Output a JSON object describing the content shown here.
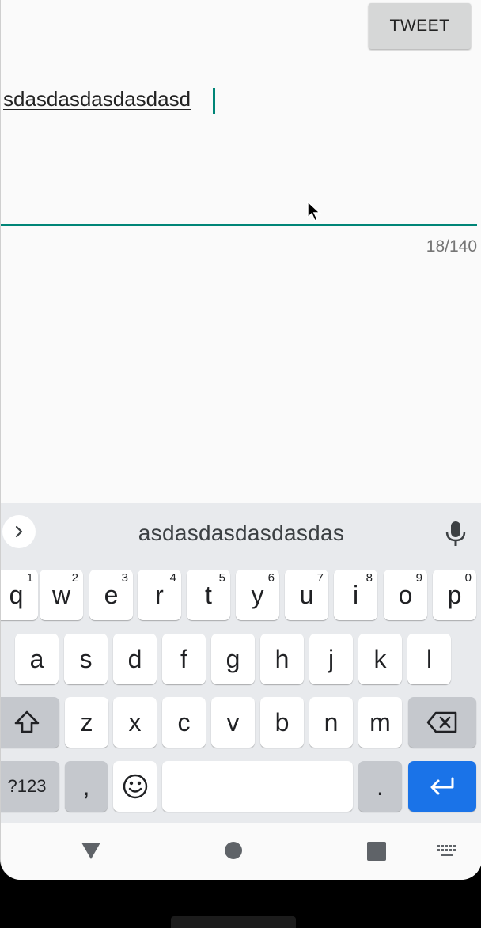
{
  "toolbar": {
    "tweet_label": "TWEET"
  },
  "compose": {
    "text": "sdasdasdasdasdasd",
    "counter": "18/140"
  },
  "keyboard": {
    "suggestion": "asdasdasdasdasdas",
    "row1": [
      {
        "label": "q",
        "hint": "1"
      },
      {
        "label": "w",
        "hint": "2"
      },
      {
        "label": "e",
        "hint": "3"
      },
      {
        "label": "r",
        "hint": "4"
      },
      {
        "label": "t",
        "hint": "5"
      },
      {
        "label": "y",
        "hint": "6"
      },
      {
        "label": "u",
        "hint": "7"
      },
      {
        "label": "i",
        "hint": "8"
      },
      {
        "label": "o",
        "hint": "9"
      },
      {
        "label": "p",
        "hint": "0"
      }
    ],
    "row2": [
      "a",
      "s",
      "d",
      "f",
      "g",
      "h",
      "j",
      "k",
      "l"
    ],
    "row3": [
      "z",
      "x",
      "c",
      "v",
      "b",
      "n",
      "m"
    ],
    "symbols_label": "?123",
    "comma_label": ",",
    "period_label": "."
  },
  "colors": {
    "accent": "#008577",
    "enter": "#1a73e8",
    "keyboard_bg": "#e8eaed"
  },
  "icons": {
    "expand": "chevron-right-icon",
    "mic": "mic-icon",
    "shift": "shift-icon",
    "backspace": "backspace-icon",
    "emoji": "emoji-icon",
    "enter": "enter-icon",
    "back": "nav-back-icon",
    "home": "nav-home-icon",
    "recents": "nav-recents-icon",
    "keyboard": "keyboard-switch-icon"
  }
}
